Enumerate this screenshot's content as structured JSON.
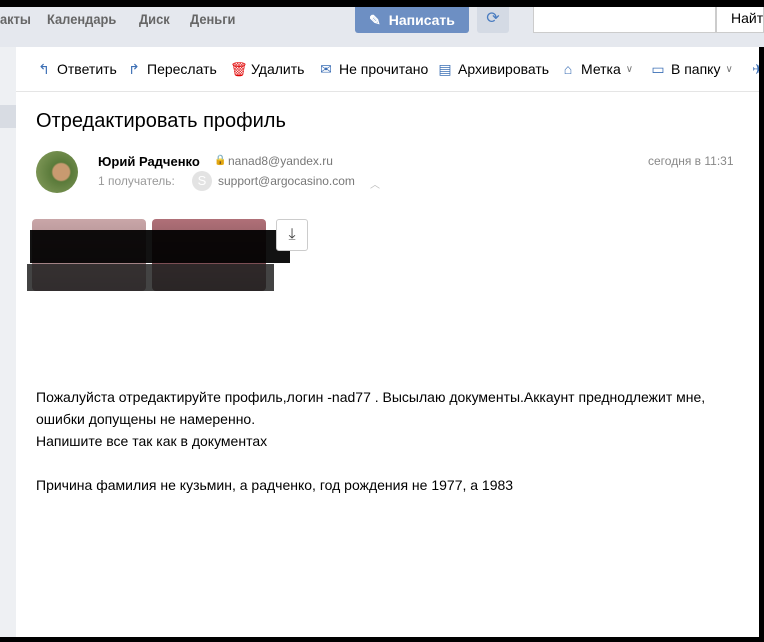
{
  "header": {
    "nav": [
      "акты",
      "Календарь",
      "Диск",
      "Деньги"
    ],
    "compose_label": "Написать",
    "search_placeholder": "",
    "find_label": "Найти"
  },
  "toolbar": {
    "reply": "Ответить",
    "forward": "Переслать",
    "delete": "Удалить",
    "unread": "Не прочитано",
    "archive": "Архивировать",
    "label": "Метка",
    "folder": "В папку"
  },
  "message": {
    "subject": "Отредактировать профиль",
    "sender_name": "Юрий Радченко",
    "sender_email": "nanad8@yandex.ru",
    "recipients_label": "1 получатель:",
    "recipient_initial": "S",
    "recipient_email": "support@argocasino.com",
    "date": "сегодня в 11:31",
    "body": [
      "Пожалуйста отредактируйте профиль,логин -nad77 . Высылаю документы.Аккаунт преднодлежит мне, ошибки допущены не намеренно.",
      "Напишите все так как в документах",
      "",
      "Причина фамилия не кузьмин, а радченко, год рождения не 1977, а 1983"
    ]
  },
  "colors": {
    "accent": "#6d8fc3",
    "delete": "#e00000"
  }
}
